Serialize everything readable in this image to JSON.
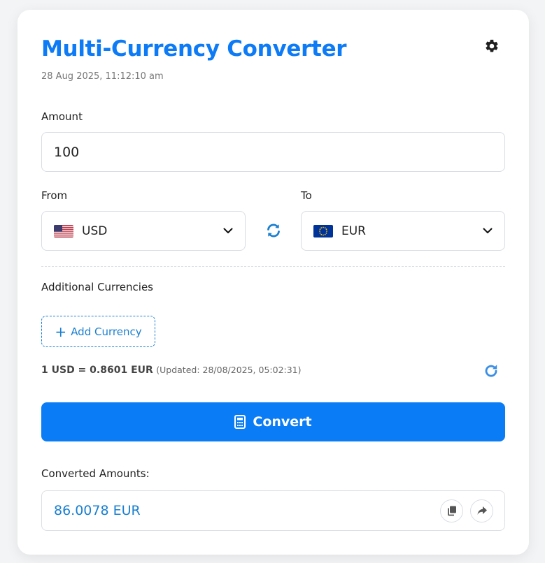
{
  "header": {
    "title": "Multi-Currency Converter",
    "timestamp": "28 Aug 2025, 11:12:10 am"
  },
  "amount": {
    "label": "Amount",
    "value": "100"
  },
  "from": {
    "label": "From",
    "currency": "USD",
    "flag": "us-flag"
  },
  "to": {
    "label": "To",
    "currency": "EUR",
    "flag": "eu-flag"
  },
  "additional": {
    "label": "Additional Currencies",
    "add_button_label": "Add Currency"
  },
  "rate": {
    "text": "1 USD = 0.8601 EUR",
    "updated": "(Updated: 28/08/2025, 05:02:31)"
  },
  "convert_button_label": "Convert",
  "results": {
    "label": "Converted Amounts:",
    "items": [
      {
        "value": "86.0078 EUR"
      }
    ]
  },
  "icons": [
    "gear-icon",
    "swap-icon",
    "chevron-down-icon",
    "plus-icon",
    "refresh-icon",
    "calculator-icon",
    "copy-icon",
    "share-icon"
  ],
  "colors": {
    "accent": "#0a7cf6",
    "title": "#0d7bf5",
    "link": "#1a7fd0"
  }
}
